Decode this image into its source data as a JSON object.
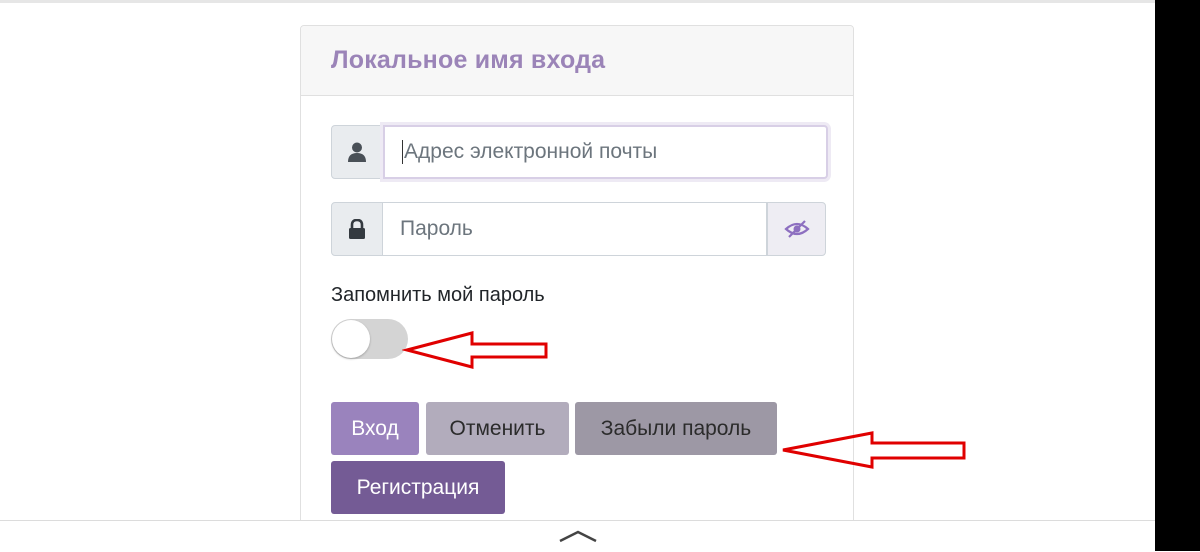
{
  "login_card": {
    "title": "Локальное имя входа",
    "email": {
      "placeholder": "Адрес электронной почты"
    },
    "password": {
      "placeholder": "Пароль"
    },
    "remember": {
      "label": "Запомнить мой пароль",
      "enabled": false
    },
    "buttons": {
      "login": "Вход",
      "cancel": "Отменить",
      "forgot": "Забыли пароль",
      "register": "Регистрация"
    }
  },
  "icons": {
    "email_addon": "user-icon",
    "password_addon": "lock-icon",
    "show_password": "eye-slash-icon",
    "bottom_handle": "chevron-up-icon"
  },
  "colors": {
    "accent": "#9a83bd",
    "title": "#9b84b8",
    "register": "#745b95",
    "annotation": "#e00000"
  }
}
